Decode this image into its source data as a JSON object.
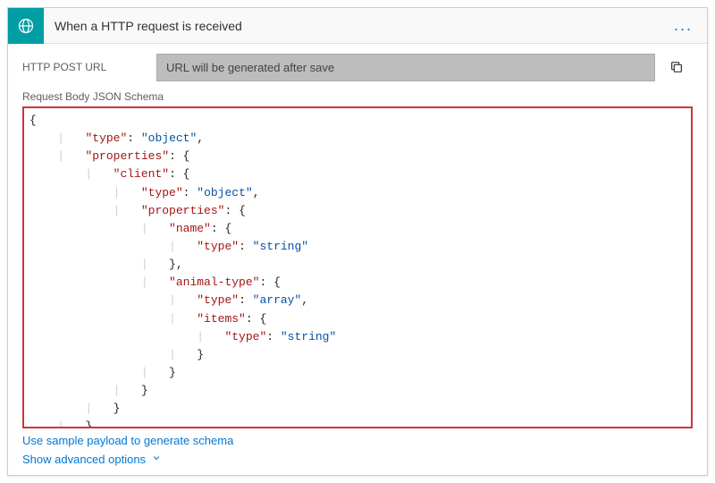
{
  "header": {
    "title": "When a HTTP request is received",
    "menu_label": "..."
  },
  "url_row": {
    "label": "HTTP POST URL",
    "value": "URL will be generated after save"
  },
  "schema": {
    "label": "Request Body JSON Schema",
    "lines": [
      [
        {
          "t": "brace",
          "v": "{"
        }
      ],
      [
        {
          "t": "indent",
          "v": "    "
        },
        {
          "t": "guide",
          "v": "|   "
        },
        {
          "t": "key",
          "v": "\"type\""
        },
        {
          "t": "colon",
          "v": ": "
        },
        {
          "t": "str",
          "v": "\"object\""
        },
        {
          "t": "plain",
          "v": ","
        }
      ],
      [
        {
          "t": "indent",
          "v": "    "
        },
        {
          "t": "guide",
          "v": "|   "
        },
        {
          "t": "key",
          "v": "\"properties\""
        },
        {
          "t": "colon",
          "v": ": "
        },
        {
          "t": "brace",
          "v": "{"
        }
      ],
      [
        {
          "t": "indent",
          "v": "        "
        },
        {
          "t": "guide",
          "v": "|   "
        },
        {
          "t": "key",
          "v": "\"client\""
        },
        {
          "t": "colon",
          "v": ": "
        },
        {
          "t": "brace",
          "v": "{"
        }
      ],
      [
        {
          "t": "indent",
          "v": "            "
        },
        {
          "t": "guide",
          "v": "|   "
        },
        {
          "t": "key",
          "v": "\"type\""
        },
        {
          "t": "colon",
          "v": ": "
        },
        {
          "t": "str",
          "v": "\"object\""
        },
        {
          "t": "plain",
          "v": ","
        }
      ],
      [
        {
          "t": "indent",
          "v": "            "
        },
        {
          "t": "guide",
          "v": "|   "
        },
        {
          "t": "key",
          "v": "\"properties\""
        },
        {
          "t": "colon",
          "v": ": "
        },
        {
          "t": "brace",
          "v": "{"
        }
      ],
      [
        {
          "t": "indent",
          "v": "                "
        },
        {
          "t": "guide",
          "v": "|   "
        },
        {
          "t": "key",
          "v": "\"name\""
        },
        {
          "t": "colon",
          "v": ": "
        },
        {
          "t": "brace",
          "v": "{"
        }
      ],
      [
        {
          "t": "indent",
          "v": "                    "
        },
        {
          "t": "guide",
          "v": "|   "
        },
        {
          "t": "key",
          "v": "\"type\""
        },
        {
          "t": "colon",
          "v": ": "
        },
        {
          "t": "str",
          "v": "\"string\""
        }
      ],
      [
        {
          "t": "indent",
          "v": "                "
        },
        {
          "t": "guide",
          "v": "|   "
        },
        {
          "t": "brace",
          "v": "}"
        },
        {
          "t": "plain",
          "v": ","
        }
      ],
      [
        {
          "t": "indent",
          "v": "                "
        },
        {
          "t": "guide",
          "v": "|   "
        },
        {
          "t": "key",
          "v": "\"animal-type\""
        },
        {
          "t": "colon",
          "v": ": "
        },
        {
          "t": "brace",
          "v": "{"
        }
      ],
      [
        {
          "t": "indent",
          "v": "                    "
        },
        {
          "t": "guide",
          "v": "|   "
        },
        {
          "t": "key",
          "v": "\"type\""
        },
        {
          "t": "colon",
          "v": ": "
        },
        {
          "t": "str",
          "v": "\"array\""
        },
        {
          "t": "plain",
          "v": ","
        }
      ],
      [
        {
          "t": "indent",
          "v": "                    "
        },
        {
          "t": "guide",
          "v": "|   "
        },
        {
          "t": "key",
          "v": "\"items\""
        },
        {
          "t": "colon",
          "v": ": "
        },
        {
          "t": "brace",
          "v": "{"
        }
      ],
      [
        {
          "t": "indent",
          "v": "                        "
        },
        {
          "t": "guide",
          "v": "|   "
        },
        {
          "t": "key",
          "v": "\"type\""
        },
        {
          "t": "colon",
          "v": ": "
        },
        {
          "t": "str",
          "v": "\"string\""
        }
      ],
      [
        {
          "t": "indent",
          "v": "                    "
        },
        {
          "t": "guide",
          "v": "|   "
        },
        {
          "t": "brace",
          "v": "}"
        }
      ],
      [
        {
          "t": "indent",
          "v": "                "
        },
        {
          "t": "guide",
          "v": "|   "
        },
        {
          "t": "brace",
          "v": "}"
        }
      ],
      [
        {
          "t": "indent",
          "v": "            "
        },
        {
          "t": "guide",
          "v": "|   "
        },
        {
          "t": "brace",
          "v": "}"
        }
      ],
      [
        {
          "t": "indent",
          "v": "        "
        },
        {
          "t": "guide",
          "v": "|   "
        },
        {
          "t": "brace",
          "v": "}"
        }
      ],
      [
        {
          "t": "indent",
          "v": "    "
        },
        {
          "t": "guide",
          "v": "|   "
        },
        {
          "t": "brace",
          "v": "}"
        }
      ],
      [
        {
          "t": "brace",
          "v": "}"
        }
      ]
    ]
  },
  "links": {
    "sample_payload": "Use sample payload to generate schema",
    "advanced": "Show advanced options"
  },
  "icons": {
    "trigger": "http-request-icon",
    "copy": "copy-icon",
    "chevron": "chevron-down-icon"
  }
}
